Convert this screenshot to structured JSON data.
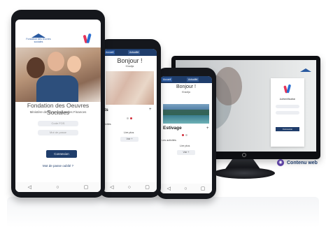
{
  "phone1": {
    "logo_text": "Fondation des Œuvres sociales",
    "title": "Fondation des Oeuvres Sociales",
    "subtitle": "Ministère de l'Économie et des Finances",
    "field1_placeholder": "Code FOS",
    "field2_placeholder": "Mot de passe",
    "login_button": "Connexion",
    "forgot_link": "Mot de passe oublié ?"
  },
  "phone2": {
    "tab_home": "Accueil",
    "tab_news": "Actualité",
    "greeting": "Bonjour !",
    "user_name": "Khadija",
    "card_label": "ts",
    "plus_label": "+",
    "section_label": "tivités",
    "link_label": "Lire plus",
    "button_label": "Voir +"
  },
  "phone3": {
    "tab_home": "Accueil",
    "tab_news": "Actualité",
    "greeting": "Bonjour !",
    "user_name": "Khadija",
    "card_label": "Estivage",
    "plus_label": "+",
    "section_label": "Les activités",
    "link_label": "Lire plus",
    "button_label": "Voir +"
  },
  "monitor": {
    "auth_title": "Authentification",
    "auth_button": "Connexion"
  },
  "badge": {
    "label": "Contenu web"
  },
  "nav": {
    "back": "◁",
    "home": "○",
    "recent": "▢"
  },
  "colors": {
    "brand": "#1f3d6b",
    "accent": "#d22f3b",
    "badge": "#5a3fa0"
  }
}
